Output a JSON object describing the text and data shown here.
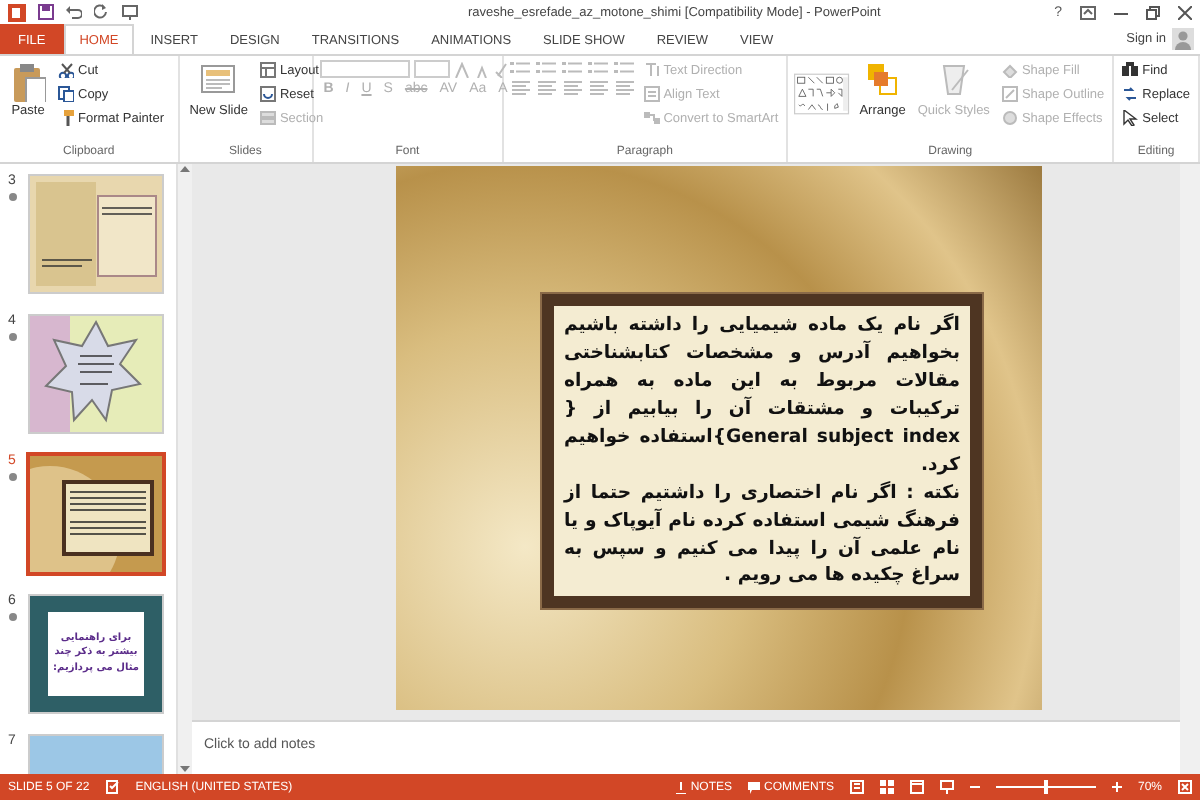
{
  "window": {
    "title": "raveshe_esrefade_az_motone_shimi [Compatibility Mode] - PowerPoint",
    "help": "?"
  },
  "tabs": [
    {
      "label": "FILE",
      "selected": false,
      "kind": "file"
    },
    {
      "label": "HOME",
      "selected": true,
      "kind": "tab"
    },
    {
      "label": "INSERT",
      "selected": false,
      "kind": "tab"
    },
    {
      "label": "DESIGN",
      "selected": false,
      "kind": "tab"
    },
    {
      "label": "TRANSITIONS",
      "selected": false,
      "kind": "tab"
    },
    {
      "label": "ANIMATIONS",
      "selected": false,
      "kind": "tab"
    },
    {
      "label": "SLIDE SHOW",
      "selected": false,
      "kind": "tab"
    },
    {
      "label": "REVIEW",
      "selected": false,
      "kind": "tab"
    },
    {
      "label": "VIEW",
      "selected": false,
      "kind": "tab"
    }
  ],
  "sign_in": "Sign in",
  "ribbon": {
    "groups": [
      {
        "label": "Clipboard",
        "items": [
          {
            "label": "Paste",
            "kind": "large",
            "disabled": false
          },
          {
            "label": "Cut",
            "kind": "small",
            "disabled": false
          },
          {
            "label": "Copy",
            "kind": "small",
            "disabled": false
          },
          {
            "label": "Format Painter",
            "kind": "small",
            "disabled": false
          }
        ]
      },
      {
        "label": "Slides",
        "items": [
          {
            "label": "New Slide",
            "kind": "large",
            "disabled": false
          },
          {
            "label": "Layout",
            "kind": "small",
            "disabled": false
          },
          {
            "label": "Reset",
            "kind": "small",
            "disabled": false
          },
          {
            "label": "Section",
            "kind": "small",
            "disabled": true
          }
        ]
      },
      {
        "label": "Font",
        "items": [
          {
            "label": "B",
            "disabled": true
          },
          {
            "label": "I",
            "disabled": true
          },
          {
            "label": "U",
            "disabled": true
          },
          {
            "label": "S",
            "disabled": true
          },
          {
            "label": "abc",
            "disabled": true
          },
          {
            "label": "AV",
            "disabled": true
          },
          {
            "label": "Aa",
            "disabled": true
          },
          {
            "label": "A",
            "disabled": true
          }
        ]
      },
      {
        "label": "Paragraph",
        "items": [
          {
            "label": "Text Direction",
            "kind": "small",
            "disabled": true
          },
          {
            "label": "Align Text",
            "kind": "small",
            "disabled": true
          },
          {
            "label": "Convert to SmartArt",
            "kind": "small",
            "disabled": true
          }
        ]
      },
      {
        "label": "Drawing",
        "items": [
          {
            "label": "Arrange",
            "kind": "large",
            "disabled": false
          },
          {
            "label": "Quick Styles",
            "kind": "large",
            "disabled": true
          },
          {
            "label": "Shape Fill",
            "kind": "small",
            "disabled": true
          },
          {
            "label": "Shape Outline",
            "kind": "small",
            "disabled": true
          },
          {
            "label": "Shape Effects",
            "kind": "small",
            "disabled": true
          }
        ]
      },
      {
        "label": "Editing",
        "items": [
          {
            "label": "Find",
            "kind": "small",
            "disabled": false
          },
          {
            "label": "Replace",
            "kind": "small",
            "disabled": false
          },
          {
            "label": "Select",
            "kind": "small",
            "disabled": false
          }
        ]
      }
    ]
  },
  "thumbnails": [
    {
      "number": "3",
      "selected": false,
      "transition": true,
      "kind": "parchment"
    },
    {
      "number": "4",
      "selected": false,
      "transition": true,
      "kind": "star"
    },
    {
      "number": "5",
      "selected": true,
      "transition": true,
      "kind": "frame"
    },
    {
      "number": "6",
      "selected": false,
      "transition": true,
      "kind": "teal",
      "text": "برای راهنمایی بیشتر به ذکر چند مثال می پردازیم:"
    },
    {
      "number": "7",
      "selected": false,
      "transition": false,
      "kind": "blue"
    }
  ],
  "slide": {
    "paragraphs": [
      "اگر نام یک ماده شیمیایی را داشته باشیم بخواهیم آدرس و مشخصات کتابشناختی مقالات مربوط به این ماده به همراه ترکیبات و مشتقات آن را بیابیم از { General subject index}استفاده خواهیم کرد.",
      "نکته : اگر نام اختصاری را داشتیم  حتما از فرهنگ شیمی استفاده کرده نام آیوپاک و یا نام علمی آن را پیدا می کنیم و سپس به سراغ چکیده ها می رویم ."
    ]
  },
  "notes": {
    "placeholder": "Click to add notes"
  },
  "status_bar": {
    "slide": "SLIDE 5 OF 22",
    "language": "ENGLISH (UNITED STATES)",
    "notes": "NOTES",
    "comments": "COMMENTS",
    "zoom": {
      "level": 0.5,
      "reading": "70%"
    }
  }
}
